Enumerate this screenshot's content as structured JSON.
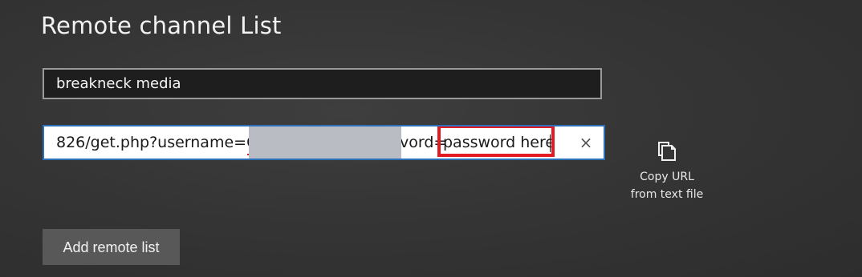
{
  "page": {
    "title": "Remote channel List"
  },
  "form": {
    "list_name_value": "breakneck media",
    "url_prefix": "826/get.php?username=C",
    "url_mid": "vord=",
    "url_password": "password here",
    "clear_icon": "close-icon",
    "clear_glyph": "×"
  },
  "copy_url": {
    "icon": "copy-icon",
    "label": "Copy URL from text file"
  },
  "actions": {
    "add_label": "Add remote list"
  },
  "colors": {
    "highlight": "#e21b23",
    "input_focus_border": "#2a6fb8",
    "redaction": "#b9bcc2"
  }
}
